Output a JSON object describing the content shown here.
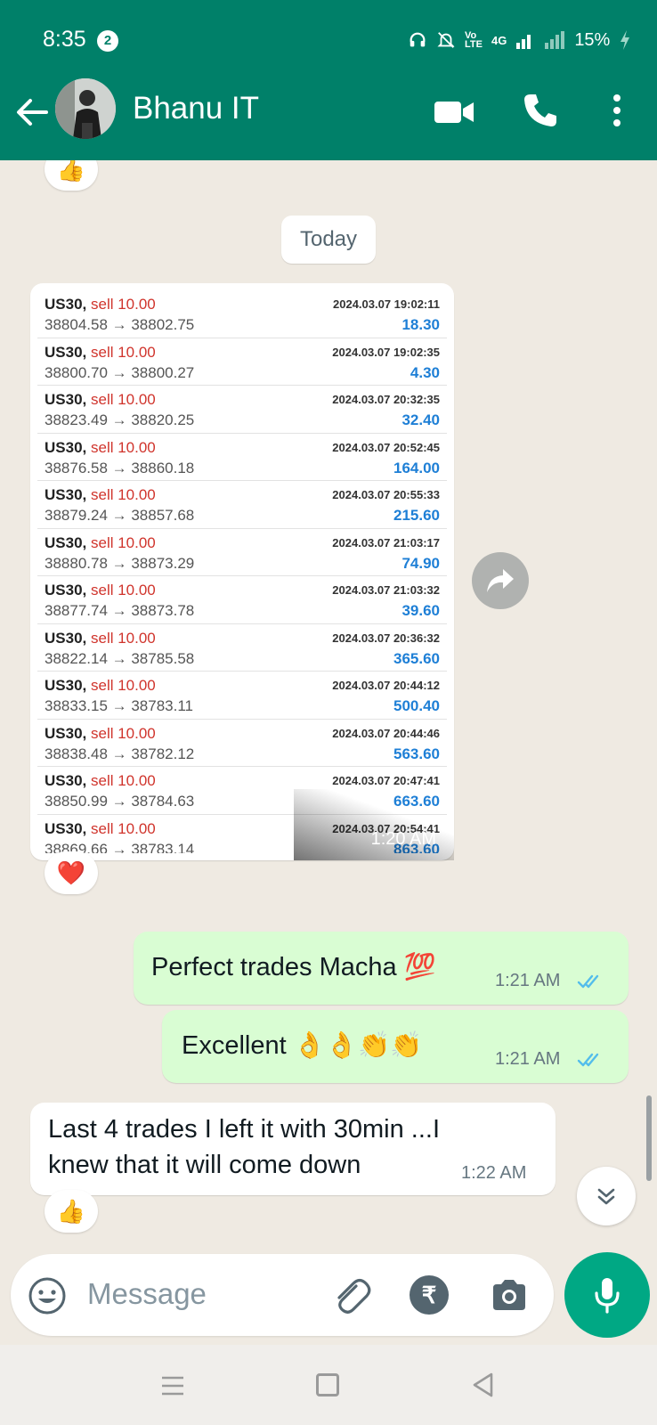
{
  "status": {
    "time": "8:35",
    "notification_count": "2",
    "volte": "Vo\nLTE",
    "signal_label": "4G",
    "battery": "15%"
  },
  "header": {
    "contact_name": "Bhanu IT"
  },
  "chat": {
    "date_chip": "Today",
    "reactions": {
      "top": "👍",
      "image": "❤️",
      "last": "👍"
    },
    "image_message": {
      "time": "1:20 AM",
      "trades": [
        {
          "symbol": "US30,",
          "side": "sell 10.00",
          "price": "38804.58 → 38802.75",
          "datetime": "2024.03.07 19:02:11",
          "profit": "18.30"
        },
        {
          "symbol": "US30,",
          "side": "sell 10.00",
          "price": "38800.70 → 38800.27",
          "datetime": "2024.03.07 19:02:35",
          "profit": "4.30"
        },
        {
          "symbol": "US30,",
          "side": "sell 10.00",
          "price": "38823.49 → 38820.25",
          "datetime": "2024.03.07 20:32:35",
          "profit": "32.40"
        },
        {
          "symbol": "US30,",
          "side": "sell 10.00",
          "price": "38876.58 → 38860.18",
          "datetime": "2024.03.07 20:52:45",
          "profit": "164.00"
        },
        {
          "symbol": "US30,",
          "side": "sell 10.00",
          "price": "38879.24 → 38857.68",
          "datetime": "2024.03.07 20:55:33",
          "profit": "215.60"
        },
        {
          "symbol": "US30,",
          "side": "sell 10.00",
          "price": "38880.78 → 38873.29",
          "datetime": "2024.03.07 21:03:17",
          "profit": "74.90"
        },
        {
          "symbol": "US30,",
          "side": "sell 10.00",
          "price": "38877.74 → 38873.78",
          "datetime": "2024.03.07 21:03:32",
          "profit": "39.60"
        },
        {
          "symbol": "US30,",
          "side": "sell 10.00",
          "price": "38822.14 → 38785.58",
          "datetime": "2024.03.07 20:36:32",
          "profit": "365.60"
        },
        {
          "symbol": "US30,",
          "side": "sell 10.00",
          "price": "38833.15 → 38783.11",
          "datetime": "2024.03.07 20:44:12",
          "profit": "500.40"
        },
        {
          "symbol": "US30,",
          "side": "sell 10.00",
          "price": "38838.48 → 38782.12",
          "datetime": "2024.03.07 20:44:46",
          "profit": "563.60"
        },
        {
          "symbol": "US30,",
          "side": "sell 10.00",
          "price": "38850.99 → 38784.63",
          "datetime": "2024.03.07 20:47:41",
          "profit": "663.60"
        },
        {
          "symbol": "US30,",
          "side": "sell 10.00",
          "price": "38869.66 → 38783.14",
          "datetime": "2024.03.07 20:54:41",
          "profit": "863.60"
        }
      ]
    },
    "messages": [
      {
        "direction": "out",
        "text": "Perfect trades Macha 💯",
        "time": "1:21 AM"
      },
      {
        "direction": "out",
        "text": "Excellent 👌👌👏👏",
        "time": "1:21 AM"
      },
      {
        "direction": "in",
        "text": "Last 4 trades I left it with 30min ...I knew that it will come down",
        "time": "1:22 AM"
      }
    ]
  },
  "composer": {
    "placeholder": "Message",
    "rupee_symbol": "₹"
  },
  "colors": {
    "header": "#008069",
    "outgoing_bubble": "#d9fdd3",
    "incoming_bubble": "#ffffff",
    "mic_button": "#00a884",
    "profit_blue": "#1e7fd6",
    "sell_red": "#d0342c",
    "ticks_blue": "#53bdeb"
  }
}
